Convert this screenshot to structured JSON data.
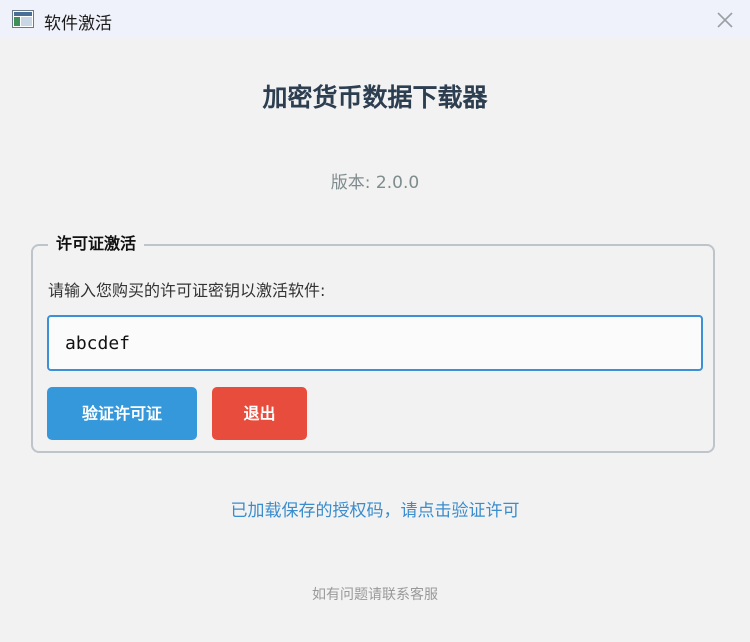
{
  "window": {
    "title": "软件激活",
    "app_icon": "app-window-icon",
    "close_icon": "close-icon"
  },
  "app": {
    "title": "加密货币数据下载器",
    "version_text": "版本: 2.0.0"
  },
  "license": {
    "group_title": "许可证激活",
    "prompt": "请输入您购买的许可证密钥以激活软件:",
    "key_value": "abcdef",
    "verify_label": "验证许可证",
    "exit_label": "退出"
  },
  "status_text": "已加载保存的授权码，请点击验证许可",
  "footer_text": "如有问题请联系客服",
  "colors": {
    "title": "#2c3e50",
    "verify_button": "#3498db",
    "exit_button": "#e74c3c",
    "status_text": "#3a8ccc",
    "input_border": "#3d8fd6"
  }
}
